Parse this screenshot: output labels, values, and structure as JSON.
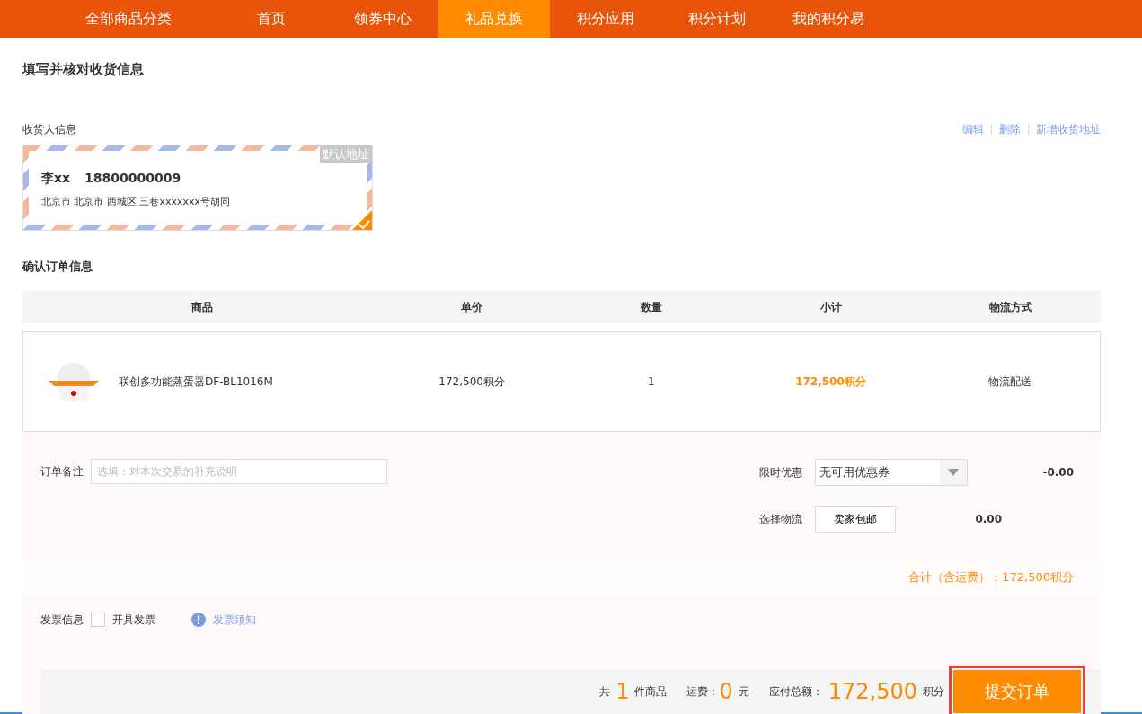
{
  "nav": [
    {
      "label": "全部商品分类",
      "kind": "category",
      "selected": false
    },
    {
      "label": "首页",
      "kind": "link",
      "selected": false
    },
    {
      "label": "领券中心",
      "kind": "link",
      "selected": false
    },
    {
      "label": "礼品兑换",
      "kind": "link",
      "selected": true
    },
    {
      "label": "积分应用",
      "kind": "link",
      "selected": false
    },
    {
      "label": "积分计划",
      "kind": "link",
      "selected": false
    },
    {
      "label": "我的积分易",
      "kind": "link",
      "selected": false
    }
  ],
  "page_title": "填写并核对收货信息",
  "consignee": {
    "heading": "收货人信息",
    "actions": [
      "编辑",
      "删除",
      "新增收货地址"
    ],
    "address": {
      "name": "李xx",
      "phone": "18800000009",
      "detail": "北京市 北京市 西城区 三巷xxxxxxx号胡同",
      "badge": "默认地址",
      "selected": true
    }
  },
  "order": {
    "heading": "确认订单信息",
    "columns": [
      "商品",
      "单价",
      "数量",
      "小计",
      "物流方式"
    ],
    "rows": [
      {
        "product": "联创多功能蒸蛋器DF-BL1016M",
        "price": "172,500积分",
        "quantity": "1",
        "subtotal": "172,500积分",
        "shipping": "物流配送"
      }
    ]
  },
  "note": {
    "label": "订单备注",
    "placeholder": "选填：对本次交易的补充说明"
  },
  "coupon": {
    "label": "限时优惠",
    "value": "无可用优惠券",
    "amount": "-0.00"
  },
  "logistics": {
    "label": "选择物流",
    "value": "卖家包邮",
    "amount": "0.00"
  },
  "total_line": "合计（含运费）：172,500积分",
  "invoice": {
    "label": "发票信息",
    "checkbox_label": "开具发票",
    "checked": false,
    "link": "发票须知"
  },
  "footer": {
    "count_prefix": "共",
    "count": "1",
    "count_suffix": "件商品",
    "freight_label": "运费：",
    "freight": "0",
    "freight_unit": "元",
    "total_label": "应付总额：",
    "total": "172,500",
    "total_unit": "积分",
    "submit": "提交订单"
  }
}
